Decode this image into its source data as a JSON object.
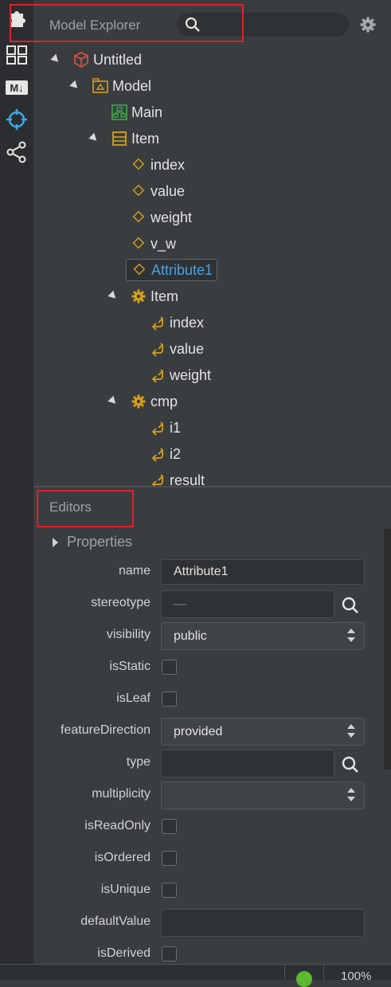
{
  "sidebar": {
    "icons": [
      "extensions-icon",
      "layout-icon",
      "markdown-icon",
      "crosshair-icon",
      "share-icon"
    ],
    "markdown_label": "M↓"
  },
  "explorer": {
    "title": "Model Explorer",
    "search_placeholder": "",
    "tree": [
      {
        "label": "Untitled",
        "icon": "project-icon",
        "expanded": true,
        "depth": 0
      },
      {
        "label": "Model",
        "icon": "model-package-icon",
        "expanded": true,
        "depth": 1
      },
      {
        "label": "Main",
        "icon": "diagram-icon",
        "depth": 2
      },
      {
        "label": "Item",
        "icon": "class-icon",
        "expanded": true,
        "depth": 2
      },
      {
        "label": "index",
        "icon": "attribute-icon",
        "depth": 3
      },
      {
        "label": "value",
        "icon": "attribute-icon",
        "depth": 3
      },
      {
        "label": "weight",
        "icon": "attribute-icon",
        "depth": 3
      },
      {
        "label": "v_w",
        "icon": "attribute-icon",
        "depth": 3
      },
      {
        "label": "Attribute1",
        "icon": "attribute-icon",
        "depth": 3,
        "selected": true
      },
      {
        "label": "Item",
        "icon": "operation-icon",
        "expanded": true,
        "depth": 3
      },
      {
        "label": "index",
        "icon": "parameter-icon",
        "depth": 4
      },
      {
        "label": "value",
        "icon": "parameter-icon",
        "depth": 4
      },
      {
        "label": "weight",
        "icon": "parameter-icon",
        "depth": 4
      },
      {
        "label": "cmp",
        "icon": "operation-icon",
        "expanded": true,
        "depth": 3
      },
      {
        "label": "i1",
        "icon": "parameter-icon",
        "depth": 4
      },
      {
        "label": "i2",
        "icon": "parameter-icon",
        "depth": 4
      },
      {
        "label": "result",
        "icon": "parameter-icon",
        "depth": 4
      }
    ]
  },
  "editors": {
    "title": "Editors",
    "section": "Properties",
    "labels": {
      "name": "name",
      "stereotype": "stereotype",
      "visibility": "visibility",
      "isStatic": "isStatic",
      "isLeaf": "isLeaf",
      "featureDirection": "featureDirection",
      "type": "type",
      "multiplicity": "multiplicity",
      "isReadOnly": "isReadOnly",
      "isOrdered": "isOrdered",
      "isUnique": "isUnique",
      "defaultValue": "defaultValue",
      "isDerived": "isDerived"
    },
    "values": {
      "name": "Attribute1",
      "stereotype_placeholder": "—",
      "visibility": "public",
      "featureDirection": "provided",
      "type": "",
      "multiplicity": "",
      "defaultValue": "",
      "isStatic": false,
      "isLeaf": false,
      "isReadOnly": false,
      "isOrdered": false,
      "isUnique": false,
      "isDerived": false
    }
  },
  "statusbar": {
    "zoom": "100%"
  },
  "colors": {
    "accent_blue": "#4d9fe0",
    "attribute_yellow": "#d4a017",
    "project_red": "#e0533d",
    "diagram_green": "#3aa84a",
    "highlight_red": "#e0202a"
  }
}
